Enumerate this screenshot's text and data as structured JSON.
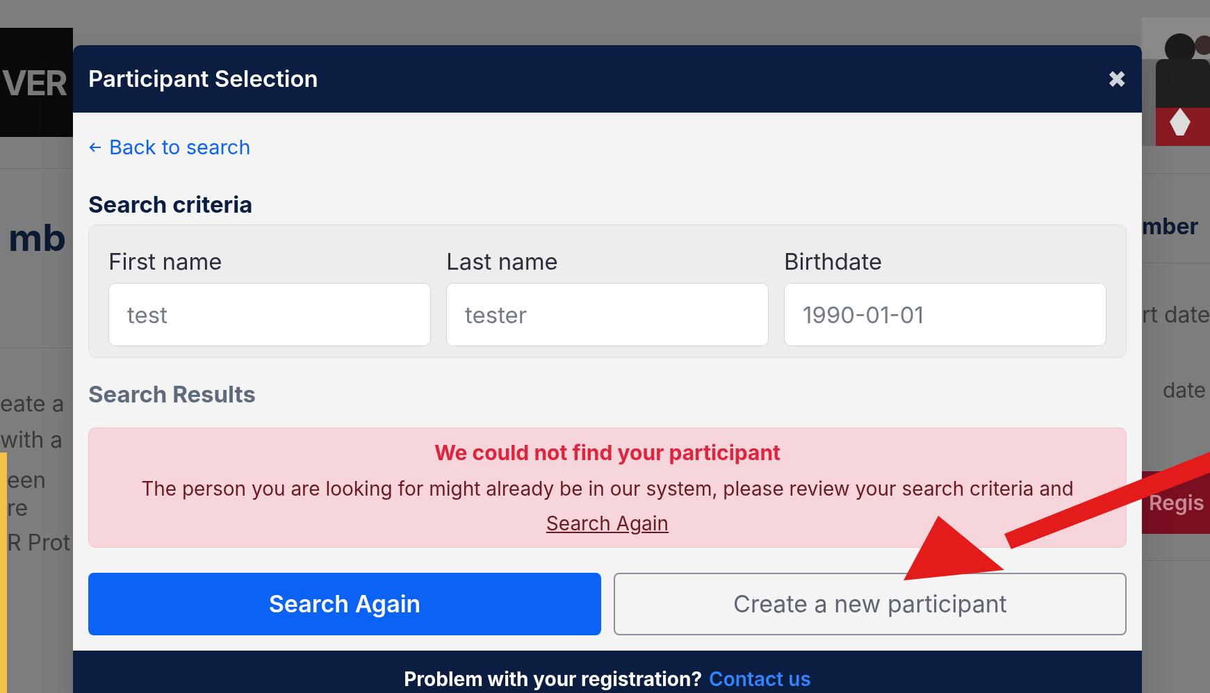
{
  "background": {
    "logo": "VER",
    "heading": "mb",
    "left_lines": [
      "eate a",
      "with a",
      "een re",
      "R Prot"
    ],
    "right_heading": "mber",
    "right_lines": [
      "rt date",
      "date"
    ],
    "register_button": "Regis"
  },
  "modal": {
    "title": "Participant Selection",
    "close": "✖",
    "back_link": "Back to search",
    "criteria_title": "Search criteria",
    "fields": [
      {
        "label": "First name",
        "value": "test"
      },
      {
        "label": "Last name",
        "value": "tester"
      },
      {
        "label": "Birthdate",
        "value": "1990-01-01"
      }
    ],
    "results_title": "Search Results",
    "alert": {
      "title": "We could not find your participant",
      "message": "The person you are looking for might already be in our system, please review your search criteria and",
      "link": "Search Again"
    },
    "buttons": [
      {
        "label": "Search Again",
        "kind": "primary"
      },
      {
        "label": "Create a new participant",
        "kind": "outline"
      }
    ],
    "footer": {
      "text": "Problem with your registration?",
      "link": "Contact us"
    }
  }
}
